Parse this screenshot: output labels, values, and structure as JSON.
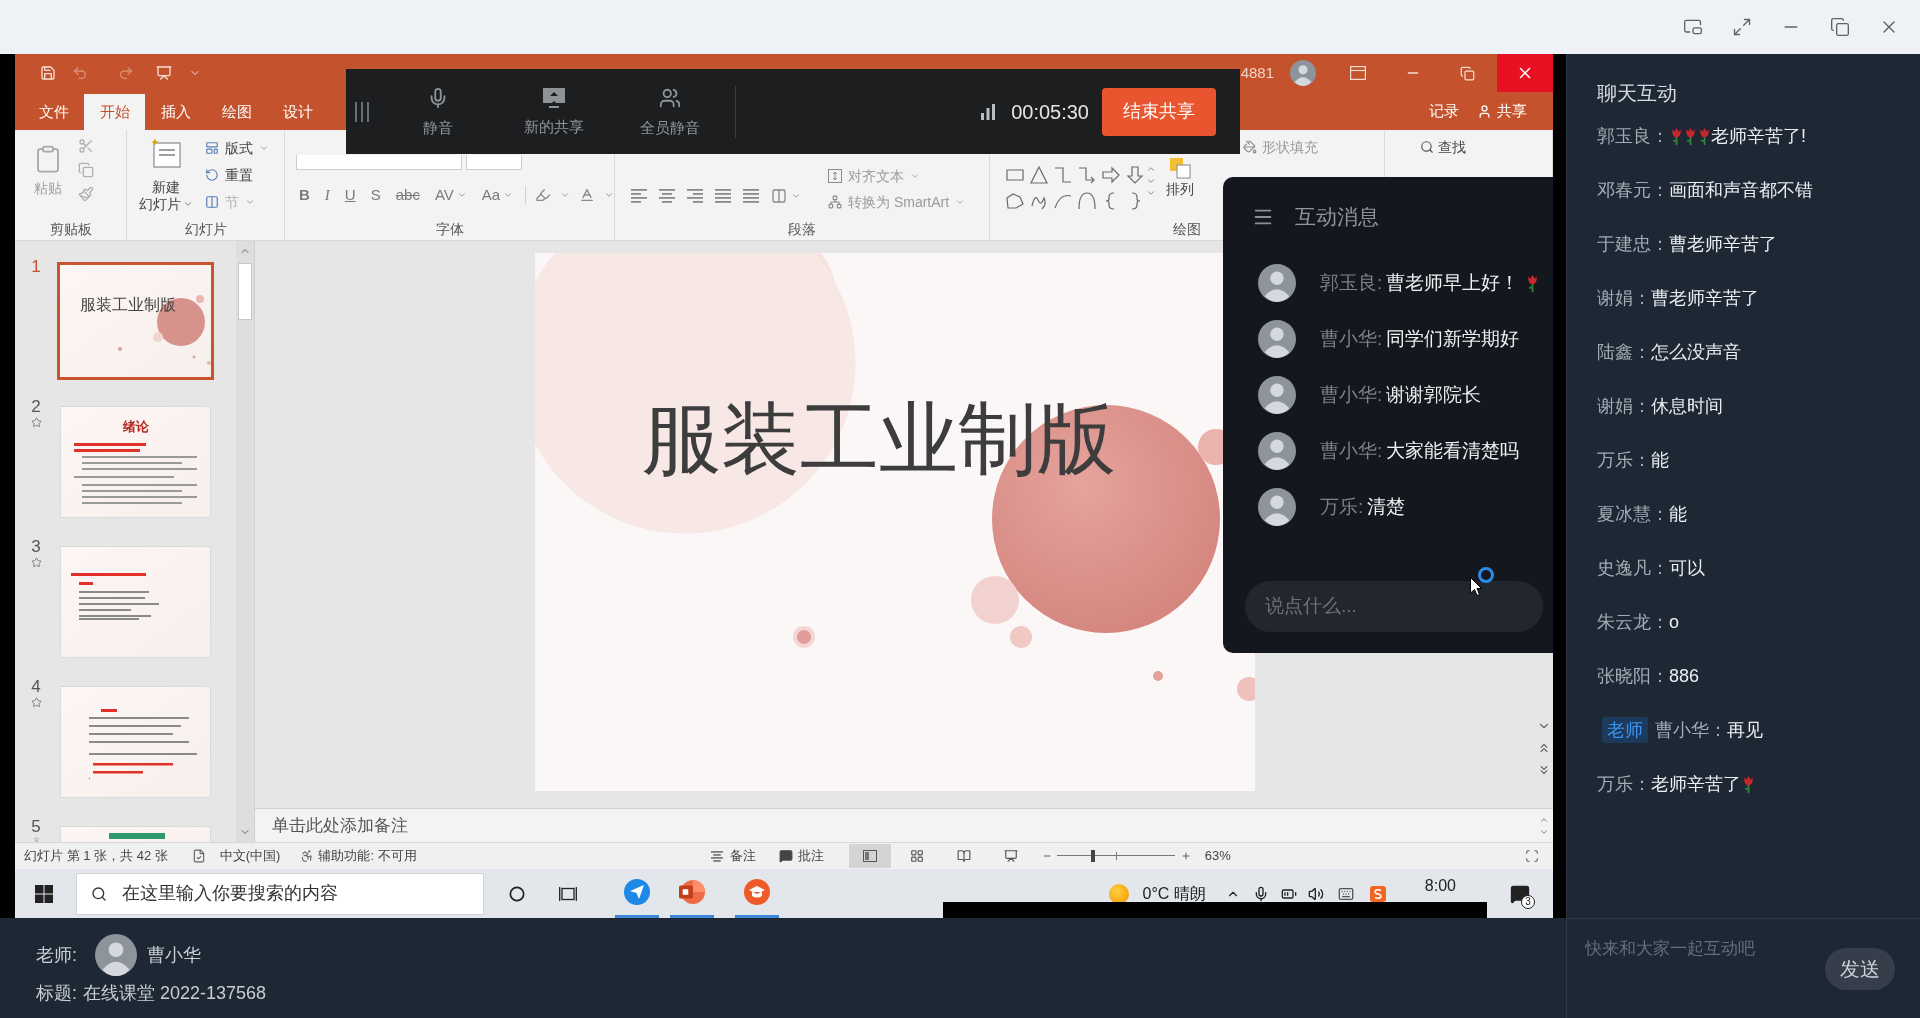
{
  "shared_screen": {
    "title_bar": {
      "account": "4881"
    },
    "ribbon_tabs": [
      {
        "label": "文件",
        "selected": false
      },
      {
        "label": "开始",
        "selected": true
      },
      {
        "label": "插入",
        "selected": false
      },
      {
        "label": "绘图",
        "selected": false
      },
      {
        "label": "设计",
        "selected": false
      }
    ],
    "ribbon_actions": [
      {
        "kind": "record",
        "label": "记录"
      },
      {
        "kind": "share",
        "label": "共享"
      }
    ],
    "ribbon": {
      "clipboard": {
        "label": "剪贴板",
        "paste": "粘贴"
      },
      "slides": {
        "label": "幻灯片",
        "new_slide": [
          "新建",
          "幻灯片"
        ],
        "layout": "版式",
        "reset": "重置",
        "section": "节"
      },
      "font": {
        "label": "字体",
        "buttons": [
          {
            "kind": "bold",
            "label": "B"
          },
          {
            "kind": "italic",
            "label": "I"
          },
          {
            "kind": "underline",
            "label": "U"
          },
          {
            "kind": "shadow",
            "label": "S"
          },
          {
            "kind": "strike",
            "label": "abc"
          },
          {
            "kind": "spacing",
            "label": "AV"
          },
          {
            "kind": "case",
            "label": "Aa"
          }
        ]
      },
      "paragraph": {
        "label": "段落",
        "align_text": "对齐文本",
        "smartart": "转换为 SmartArt"
      },
      "drawing": {
        "label": "绘图",
        "arrange": "排列",
        "shape_fill": "形状填充"
      },
      "editing": {
        "find": "查找"
      }
    },
    "slides_panel": {
      "slides": [
        {
          "number": "1",
          "selected": true,
          "animated": false,
          "kind": "title",
          "title": "服装工业制版"
        },
        {
          "number": "2",
          "selected": false,
          "animated": true,
          "kind": "outline",
          "title": "绪论"
        },
        {
          "number": "3",
          "selected": false,
          "animated": true,
          "kind": "list"
        },
        {
          "number": "4",
          "selected": false,
          "animated": true,
          "kind": "paragraph"
        },
        {
          "number": "5",
          "selected": false,
          "animated": true,
          "kind": "section"
        }
      ]
    },
    "slide": {
      "title": "服装工业制版"
    },
    "notes": {
      "placeholder": "单击此处添加备注"
    },
    "status_bar": {
      "slide_info": "幻灯片 第 1 张，共 42 张",
      "language": "中文(中国)",
      "accessibility": "辅助功能: 不可用",
      "notes": "备注",
      "comments": "批注",
      "views": [
        {
          "kind": "normal",
          "selected": true
        },
        {
          "kind": "sorter",
          "selected": false
        },
        {
          "kind": "reading",
          "selected": false
        },
        {
          "kind": "show",
          "selected": false
        }
      ],
      "zoom": {
        "level": 0.31,
        "reading": "63%"
      }
    },
    "taskbar": {
      "search": {
        "placeholder": "在这里输入你要搜索的内容"
      },
      "apps": [
        {
          "kind": "messenger",
          "running": true
        },
        {
          "kind": "powerpoint",
          "running": true
        },
        {
          "kind": "classroom",
          "running": true
        }
      ],
      "weather": "0°C 晴朗",
      "time": "8:00",
      "notifications": "3"
    }
  },
  "share_toolbar": {
    "buttons": [
      {
        "kind": "mic",
        "label": "静音"
      },
      {
        "kind": "screen",
        "label": "新的共享"
      },
      {
        "kind": "mute_all",
        "label": "全员静音"
      }
    ],
    "timer": "00:05:30",
    "stop": "结束共享"
  },
  "message_panel": {
    "title": "互动消息",
    "messages": [
      {
        "name": "郭玉良:",
        "parts": [
          {
            "kind": "text",
            "text": "曹老师早上好！"
          },
          {
            "kind": "rose"
          }
        ]
      },
      {
        "name": "曹小华:",
        "parts": [
          {
            "kind": "text",
            "text": "同学们新学期好"
          }
        ]
      },
      {
        "name": "曹小华:",
        "parts": [
          {
            "kind": "text",
            "text": "谢谢郭院长"
          }
        ]
      },
      {
        "name": "曹小华:",
        "parts": [
          {
            "kind": "text",
            "text": "大家能看清楚吗"
          }
        ]
      },
      {
        "name": "万乐:",
        "parts": [
          {
            "kind": "text",
            "text": "清楚"
          }
        ]
      }
    ],
    "input": {
      "placeholder": "说点什么..."
    }
  },
  "chat": {
    "title": "聊天互动",
    "messages": [
      {
        "name": "郭玉良：",
        "parts": [
          {
            "kind": "rose"
          },
          {
            "kind": "rose"
          },
          {
            "kind": "rose"
          },
          {
            "kind": "text",
            "text": "老师辛苦了!"
          }
        ]
      },
      {
        "name": "邓春元：",
        "parts": [
          {
            "kind": "text",
            "text": "画面和声音都不错"
          }
        ]
      },
      {
        "name": "于建忠：",
        "parts": [
          {
            "kind": "text",
            "text": "曹老师辛苦了"
          }
        ]
      },
      {
        "name": "谢娟：",
        "parts": [
          {
            "kind": "text",
            "text": "曹老师辛苦了"
          }
        ]
      },
      {
        "name": "陆鑫：",
        "parts": [
          {
            "kind": "text",
            "text": "怎么没声音"
          }
        ]
      },
      {
        "name": "谢娟：",
        "parts": [
          {
            "kind": "text",
            "text": "休息时间"
          }
        ]
      },
      {
        "name": "万乐：",
        "parts": [
          {
            "kind": "text",
            "text": "能"
          }
        ]
      },
      {
        "name": "夏冰慧：",
        "parts": [
          {
            "kind": "text",
            "text": "能"
          }
        ]
      },
      {
        "name": "史逸凡：",
        "parts": [
          {
            "kind": "text",
            "text": "可以"
          }
        ]
      },
      {
        "name": "朱云龙：",
        "parts": [
          {
            "kind": "text",
            "text": "o"
          }
        ]
      },
      {
        "name": "张晓阳：",
        "parts": [
          {
            "kind": "text",
            "text": "886"
          }
        ]
      },
      {
        "badge": "老师",
        "name": "曹小华：",
        "parts": [
          {
            "kind": "text",
            "text": "再见"
          }
        ]
      },
      {
        "name": "万乐：",
        "parts": [
          {
            "kind": "text",
            "text": "老师辛苦了"
          },
          {
            "kind": "rose"
          }
        ]
      }
    ],
    "input": {
      "placeholder": "快来和大家一起互动吧"
    },
    "send": "发送"
  },
  "class_info": {
    "teacher_label": "老师:",
    "teacher_name": "曹小华",
    "title_label": "标题:",
    "title": "在线课堂 2022-137568"
  }
}
